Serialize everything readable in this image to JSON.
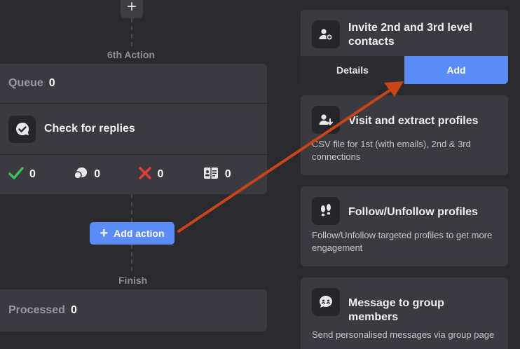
{
  "workflow": {
    "add_step_glyph": "+",
    "step_label": "6th Action",
    "queue": {
      "label": "Queue",
      "count": "0"
    },
    "action": {
      "title": "Check for replies",
      "icon": "chat-bubble-check-icon"
    },
    "stats": [
      {
        "icon": "check-icon",
        "value": "0",
        "color": "#3cc15a"
      },
      {
        "icon": "chat-bubbles-icon",
        "value": "0",
        "color": "#e8e8ea"
      },
      {
        "icon": "cross-icon",
        "value": "0",
        "color": "#e5393b"
      },
      {
        "icon": "address-book-icon",
        "value": "0",
        "color": "#e8e8ea"
      }
    ],
    "add_action_label": "Add action",
    "finish_label": "Finish",
    "processed": {
      "label": "Processed",
      "count": "0"
    }
  },
  "actions_panel": [
    {
      "title": "Invite 2nd and 3rd level contacts",
      "icon": "user-plus-icon",
      "tabs": {
        "details": "Details",
        "add": "Add"
      }
    },
    {
      "title": "Visit and extract profiles",
      "icon": "user-download-icon",
      "description": "CSV file for 1st (with emails), 2nd & 3rd connections"
    },
    {
      "title": "Follow/Unfollow profiles",
      "icon": "footprints-icon",
      "description": "Follow/Unfollow targeted profiles to get more engagement"
    },
    {
      "title": "Message to group members",
      "icon": "group-chat-icon",
      "description": "Send personalised messages via group page"
    }
  ],
  "colors": {
    "accent": "#5b8cf5",
    "annotation_arrow": "#c8441a",
    "background": "#2b2b2f",
    "card": "#3a3a40"
  }
}
